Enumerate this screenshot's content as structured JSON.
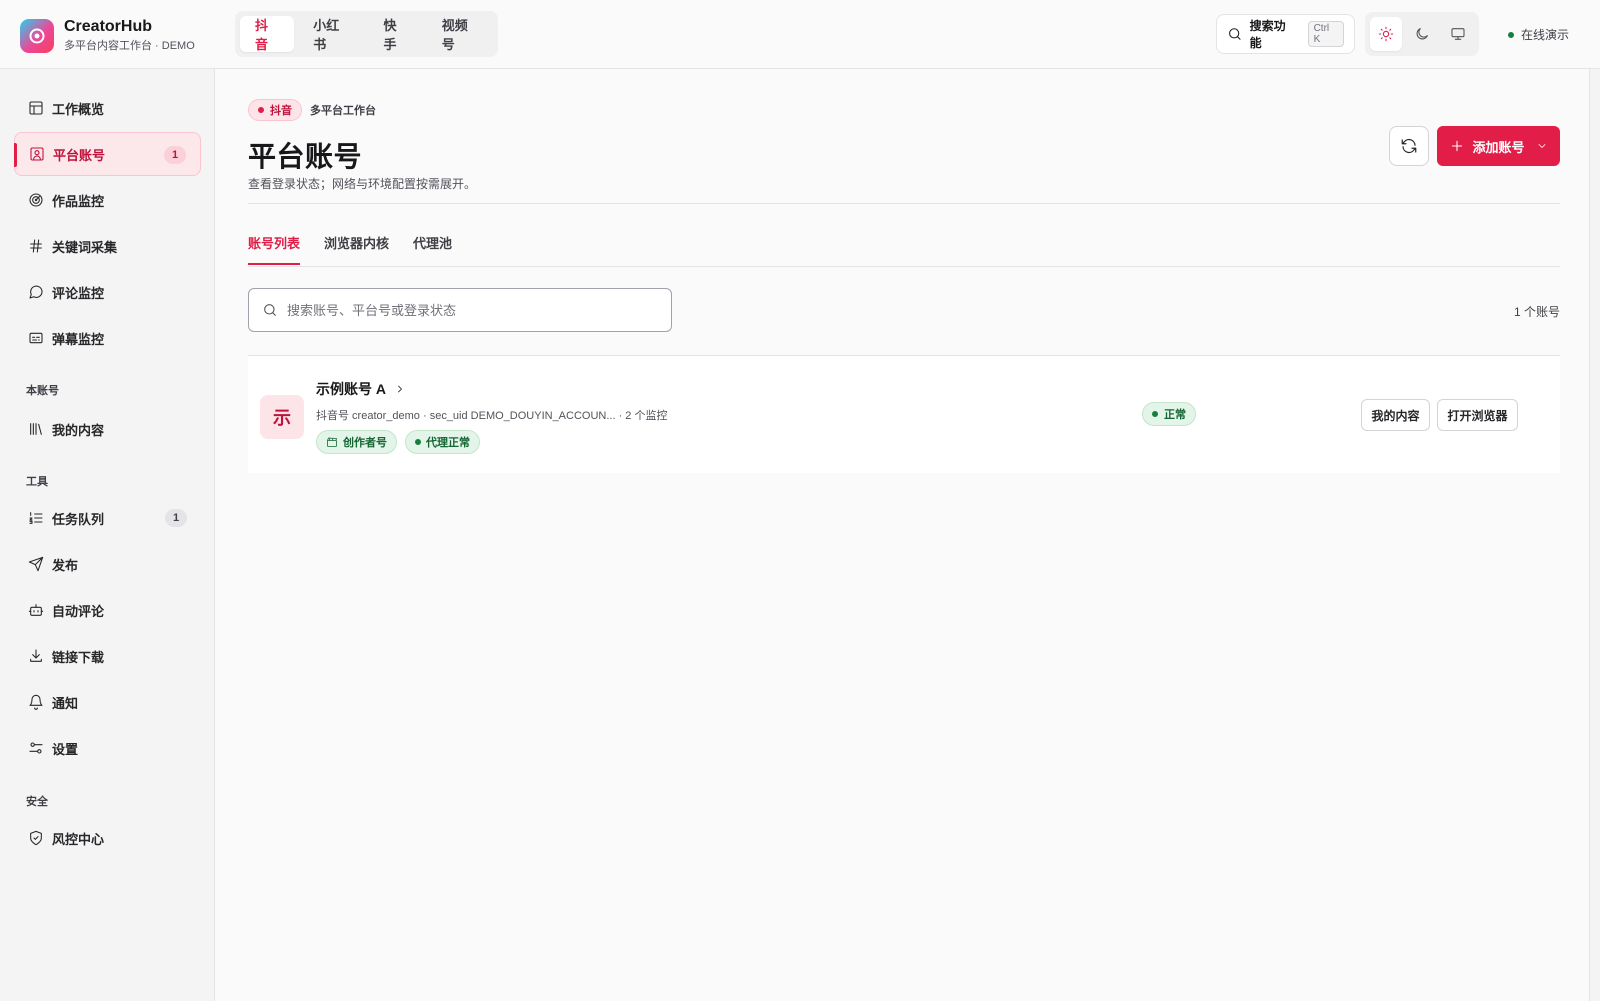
{
  "brand": {
    "name": "CreatorHub",
    "subtitle": "多平台内容工作台 · DEMO"
  },
  "platform_tabs": [
    {
      "label": "抖音",
      "active": true
    },
    {
      "label": "小红书",
      "active": false
    },
    {
      "label": "快手",
      "active": false
    },
    {
      "label": "视频号",
      "active": false
    }
  ],
  "search": {
    "label": "搜索功能",
    "shortcut": "Ctrl K"
  },
  "theme": {
    "options": [
      "sun-icon",
      "moon-icon",
      "monitor-icon"
    ],
    "active": "sun-icon"
  },
  "status": {
    "online_label": "在线演示"
  },
  "sidebar": {
    "items": [
      {
        "label": "工作概览",
        "icon": "layout-icon"
      },
      {
        "label": "平台账号",
        "icon": "user-square-icon",
        "badge": "1",
        "active": true
      },
      {
        "label": "作品监控",
        "icon": "radar-icon"
      },
      {
        "label": "关键词采集",
        "icon": "hash-icon"
      },
      {
        "label": "评论监控",
        "icon": "message-circle-icon"
      },
      {
        "label": "弹幕监控",
        "icon": "subtitles-icon"
      }
    ],
    "section_self": "本账号",
    "self_items": [
      {
        "label": "我的内容",
        "icon": "library-icon"
      }
    ],
    "section_tools": "工具",
    "tool_items": [
      {
        "label": "任务队列",
        "icon": "list-ordered-icon",
        "badge": "1"
      },
      {
        "label": "发布",
        "icon": "send-icon"
      },
      {
        "label": "自动评论",
        "icon": "bot-icon"
      },
      {
        "label": "链接下载",
        "icon": "download-icon"
      },
      {
        "label": "通知",
        "icon": "bell-icon"
      },
      {
        "label": "设置",
        "icon": "sliders-icon"
      }
    ],
    "section_security": "安全",
    "security_items": [
      {
        "label": "风控中心",
        "icon": "shield-check-icon"
      }
    ]
  },
  "page": {
    "platform_badge": "抖音",
    "breadcrumb": "多平台工作台",
    "title": "平台账号",
    "description": "查看登录状态；网络与环境配置按需展开。",
    "add_button": "添加账号"
  },
  "sub_tabs": [
    {
      "label": "账号列表",
      "active": true
    },
    {
      "label": "浏览器内核",
      "active": false
    },
    {
      "label": "代理池",
      "active": false
    }
  ],
  "account_search": {
    "placeholder": "搜索账号、平台号或登录状态",
    "value": ""
  },
  "account_count": "1 个账号",
  "accounts": [
    {
      "avatar_char": "示",
      "name": "示例账号 A",
      "meta": "抖音号 creator_demo · sec_uid DEMO_DOUYIN_ACCOUN... · 2 个监控",
      "tags": [
        "创作者号",
        "代理正常"
      ],
      "status": "正常",
      "actions": [
        "我的内容",
        "打开浏览器"
      ]
    }
  ],
  "colors": {
    "accent": "#e11d48",
    "success": "#166534"
  }
}
